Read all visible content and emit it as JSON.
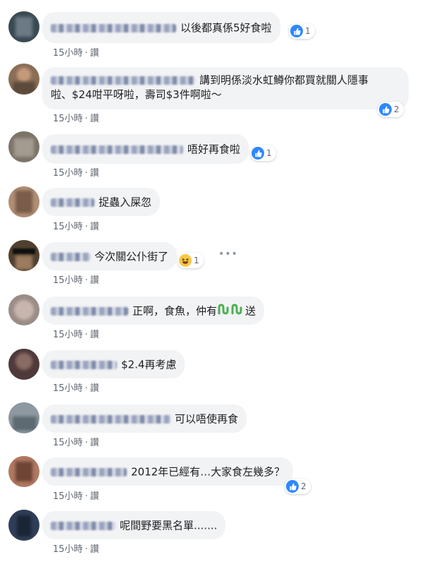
{
  "comments": [
    {
      "text": "以後都真係5好食啦",
      "time": "15小時",
      "action": "讚",
      "reaction_count": "1",
      "reaction": "like"
    },
    {
      "text_line1": "講到明係淡水虹鱒你都買就關人隱事",
      "text_line2": "啦、$24咁平呀啦，壽司$3件啊啦～",
      "time": "15小時",
      "action": "讚",
      "reaction_count": "2",
      "reaction": "like"
    },
    {
      "text": "唔好再食啦",
      "time": "15小時",
      "action": "讚",
      "reaction_count": "1",
      "reaction": "like"
    },
    {
      "text": "捉蟲入屎忽",
      "time": "15小時",
      "action": "讚"
    },
    {
      "text": "今次關公仆街了",
      "time": "15小時",
      "action": "讚",
      "reaction_count": "1",
      "reaction": "haha"
    },
    {
      "text_before": "正啊，食魚，仲有",
      "text_after": "送",
      "time": "15小時",
      "action": "讚"
    },
    {
      "text": "$2.4再考慮",
      "time": "15小時",
      "action": "讚"
    },
    {
      "text": "可以唔使再食",
      "time": "15小時",
      "action": "讚"
    },
    {
      "text": "2012年已經有…大家食左幾多？",
      "time": "15小時",
      "action": "讚",
      "reaction_count": "2",
      "reaction": "like"
    },
    {
      "text": "呢間野要黑名單.......",
      "time": "15小時",
      "action": "讚"
    }
  ],
  "colors": {
    "like_blue": "#2d88ff",
    "bubble_bg": "#f2f3f5",
    "meta_gray": "#606770"
  },
  "icons": {
    "like": "thumbs-up-icon",
    "haha": "laughing-face-icon",
    "more": "more-options-icon",
    "worm": "worm-emoji-icon"
  }
}
